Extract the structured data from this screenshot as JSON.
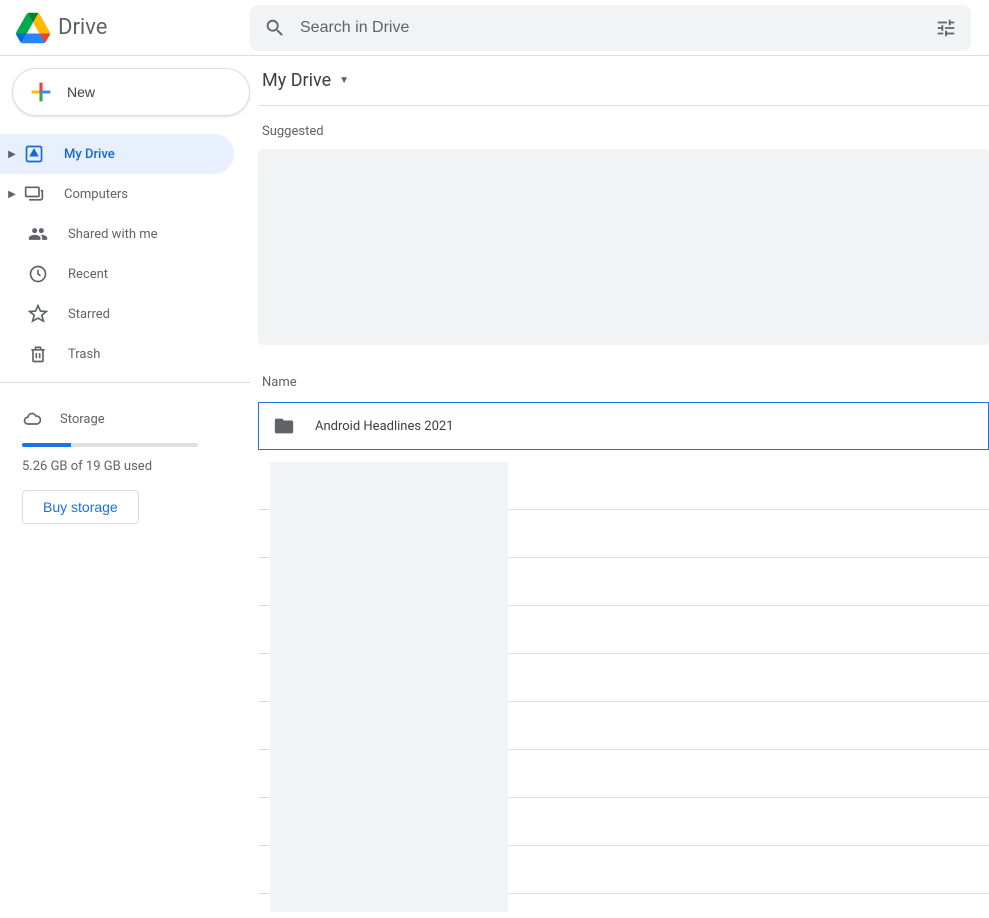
{
  "app": {
    "name": "Drive"
  },
  "search": {
    "placeholder": "Search in Drive"
  },
  "newButton": {
    "label": "New"
  },
  "sidebar": {
    "items": [
      {
        "label": "My Drive"
      },
      {
        "label": "Computers"
      },
      {
        "label": "Shared with me"
      },
      {
        "label": "Recent"
      },
      {
        "label": "Starred"
      },
      {
        "label": "Trash"
      }
    ],
    "storage": {
      "label": "Storage",
      "used_text": "5.26 GB of 19 GB used",
      "buy_label": "Buy storage"
    }
  },
  "main": {
    "breadcrumb": "My Drive",
    "suggested_label": "Suggested",
    "name_header": "Name",
    "rows": [
      {
        "name": "Android Headlines 2021"
      }
    ]
  }
}
